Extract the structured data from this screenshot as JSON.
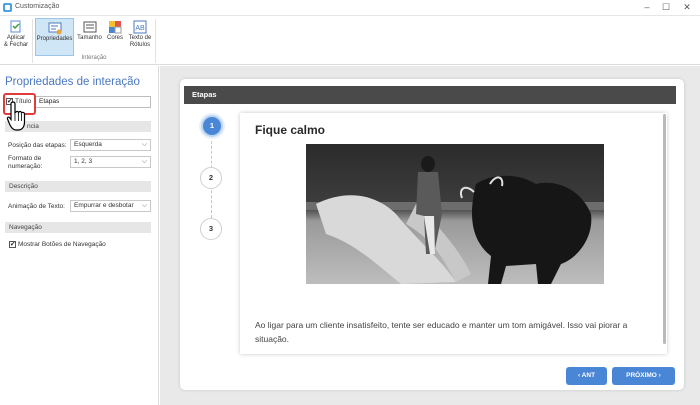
{
  "window": {
    "title": "Customização",
    "minimize": "–",
    "maximize": "☐",
    "close": "✕"
  },
  "ribbon": {
    "buttons": [
      {
        "label_line1": "Aplicar",
        "label_line2": "& Fechar",
        "icon": "apply-close-icon"
      },
      {
        "label_line1": "Propriedades",
        "label_line2": "",
        "icon": "properties-icon"
      },
      {
        "label_line1": "Tamanho",
        "label_line2": "",
        "icon": "size-icon"
      },
      {
        "label_line1": "Cores",
        "label_line2": "",
        "icon": "colors-icon"
      },
      {
        "label_line1": "Texto de",
        "label_line2": "Rótulos",
        "icon": "label-text-icon"
      }
    ],
    "group_label": "Interação"
  },
  "panel": {
    "title": "Propriedades de interação",
    "title_checkbox_label": "Título",
    "title_checkbox_checked": "✔",
    "title_value": "Etapas",
    "section_appearance": "ncia",
    "step_position_label": "Posição das etapas:",
    "step_position_value": "Esquerda",
    "numbering_label_1": "Formato de",
    "numbering_label_2": "numeração:",
    "numbering_value": "1, 2, 3",
    "section_description": "Descrição",
    "text_animation_label": "Animação de Texto:",
    "text_animation_value": "Empurrar e desbotar",
    "section_navigation": "Navegação",
    "show_nav_label": "Mostrar Botões de Navegação",
    "show_nav_checked": "✔",
    "chevron": "⌵"
  },
  "preview": {
    "header": "Etapas",
    "steps": [
      "1",
      "2",
      "3"
    ],
    "content_title": "Fique calmo",
    "content_text": "Ao ligar para um cliente insatisfeito, tente ser educado e manter um tom amigável. Isso vai piorar a situação.",
    "prev_label": "‹  ANT",
    "next_label": "PRÓXIMO  ›"
  },
  "colors": {
    "accent": "#4a86d6",
    "panel_title": "#4a78c2",
    "highlight": "#e23b3b",
    "header_bg": "#4a4a4a"
  }
}
